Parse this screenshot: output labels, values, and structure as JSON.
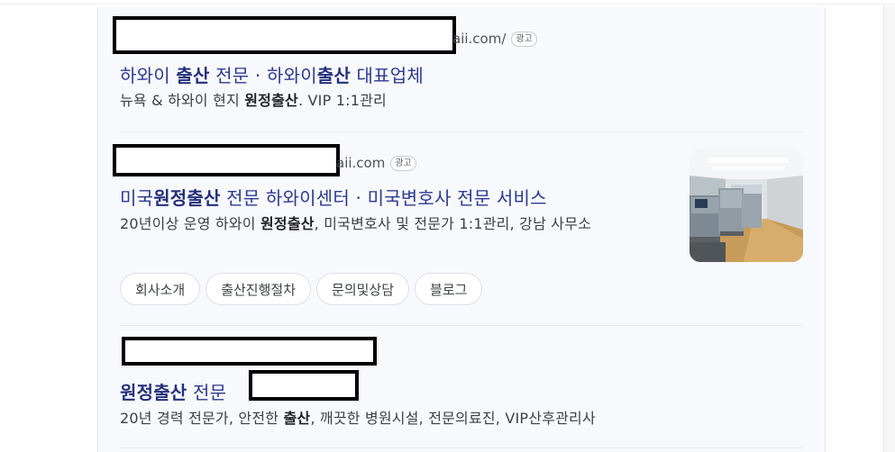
{
  "ads": [
    {
      "domain_tail": "aii.com/",
      "badge": "광고",
      "title_parts": [
        {
          "t": "하와이 ",
          "b": false
        },
        {
          "t": "출산",
          "b": true
        },
        {
          "t": " 전문 · 하와이",
          "b": false
        },
        {
          "t": "출산",
          "b": true
        },
        {
          "t": " 대표업체",
          "b": false
        }
      ],
      "desc_parts": [
        {
          "t": "뉴욕 & 하와이 현지 ",
          "b": false
        },
        {
          "t": "원정출산",
          "b": true
        },
        {
          "t": ". VIP 1:1관리",
          "b": false
        }
      ]
    },
    {
      "domain_tail": "aii.com",
      "badge": "광고",
      "title_parts": [
        {
          "t": "미국",
          "b": false
        },
        {
          "t": "원정출산",
          "b": true
        },
        {
          "t": " 전문 하와이센터 · 미국변호사 전문 서비스",
          "b": false
        }
      ],
      "desc_parts": [
        {
          "t": "20년이상 운영 하와이 ",
          "b": false
        },
        {
          "t": "원정출산",
          "b": true
        },
        {
          "t": ", 미국변호사 및 전문가 1:1관리, 강남 사무소",
          "b": false
        }
      ],
      "sitelinks": [
        "회사소개",
        "출산진행절차",
        "문의및상담",
        "블로그"
      ]
    },
    {
      "title_parts": [
        {
          "t": "원정출산",
          "b": true
        },
        {
          "t": " 전문",
          "b": false
        }
      ],
      "desc_parts": [
        {
          "t": "20년 경력 전문가, 안전한 ",
          "b": false
        },
        {
          "t": "출산",
          "b": true
        },
        {
          "t": ", 깨끗한 병원시설, 전문의료진, VIP산후관리사",
          "b": false
        }
      ]
    }
  ],
  "colors": {
    "title": "#2b3a8f",
    "panel_bg": "#f8f9fd",
    "redaction": "#000000"
  },
  "thumbnail": {
    "icon": "office-photo"
  }
}
